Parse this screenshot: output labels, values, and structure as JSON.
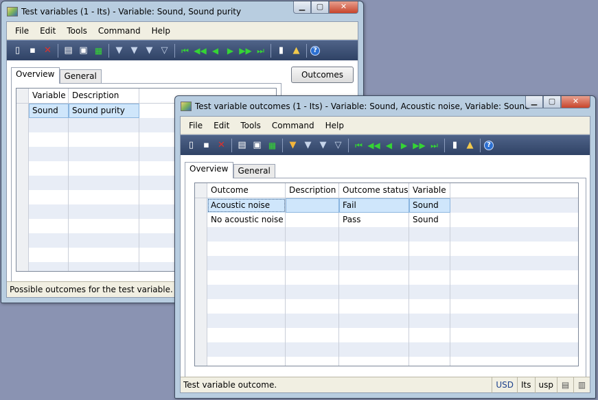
{
  "window1": {
    "title": "Test variables (1 - Its) - Variable: Sound, Sound purity",
    "menu": [
      "File",
      "Edit",
      "Tools",
      "Command",
      "Help"
    ],
    "tabs": [
      "Overview",
      "General"
    ],
    "outcomes_button": "Outcomes",
    "columns": [
      "Variable",
      "Description"
    ],
    "rows": [
      {
        "variable": "Sound",
        "description": "Sound purity"
      }
    ],
    "status": "Possible outcomes for the test variable."
  },
  "window2": {
    "title": "Test variable outcomes (1 - Its) - Variable: Sound, Acoustic noise, Variable: Sound",
    "menu": [
      "File",
      "Edit",
      "Tools",
      "Command",
      "Help"
    ],
    "tabs": [
      "Overview",
      "General"
    ],
    "columns": [
      "Outcome",
      "Description",
      "Outcome status",
      "Variable"
    ],
    "rows": [
      {
        "outcome": "Acoustic noise",
        "description": "",
        "status": "Fail",
        "variable": "Sound"
      },
      {
        "outcome": "No acoustic noise",
        "description": "",
        "status": "Pass",
        "variable": "Sound"
      }
    ],
    "status": "Test variable outcome.",
    "status_fields": {
      "currency": "USD",
      "company": "Its",
      "layer": "usp"
    }
  },
  "window_buttons": {
    "minimize": "▁",
    "maximize": "▢",
    "close": "✕"
  },
  "toolbar_icons": [
    "new-icon",
    "save-icon",
    "delete-icon",
    "print-icon",
    "print-preview-icon",
    "excel-icon",
    "filter-by-selection-icon",
    "filter-by-grid-icon",
    "advanced-filter-icon",
    "remove-filter-icon",
    "first-record-icon",
    "previous-page-icon",
    "previous-record-icon",
    "next-record-icon",
    "next-page-icon",
    "last-record-icon",
    "document-handling-icon",
    "alert-icon",
    "help-icon"
  ]
}
